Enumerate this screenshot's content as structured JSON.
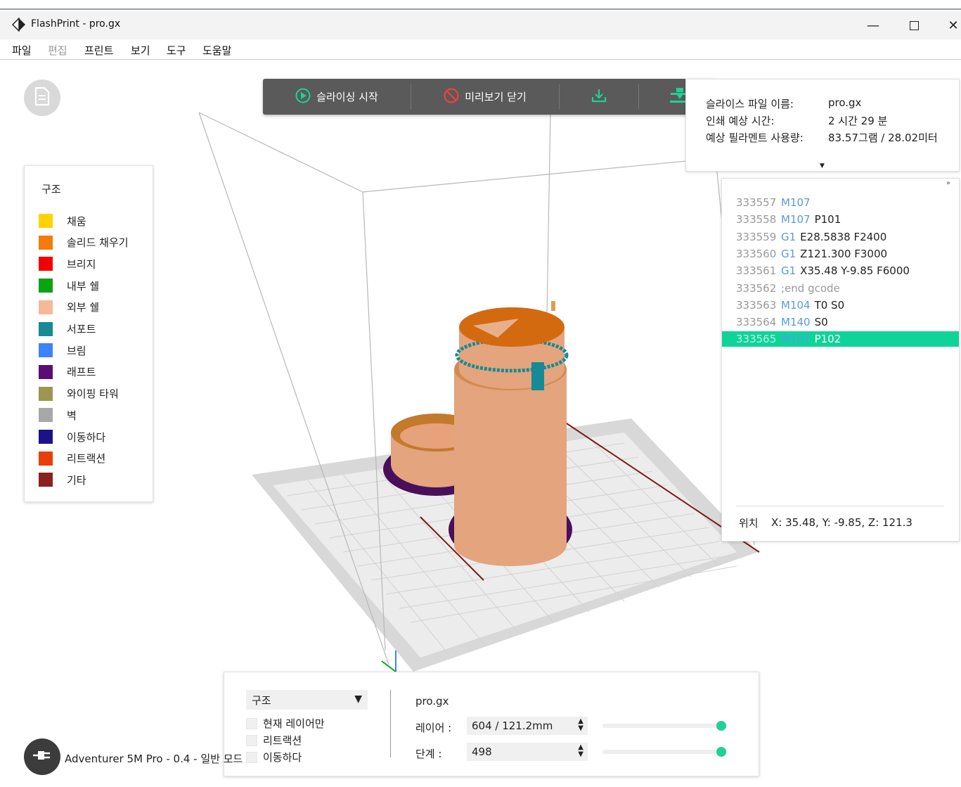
{
  "window": {
    "title": "FlashPrint - pro.gx",
    "icon": "flashprint-logo-icon",
    "controls": [
      "minimize-icon",
      "maximize-icon",
      "close-icon"
    ]
  },
  "menu": [
    "파일",
    "편집",
    "프린트",
    "보기",
    "도구",
    "도움말"
  ],
  "toolbar": {
    "slice_label": "슬라이싱 시작",
    "close_preview_label": "미리보기 닫기",
    "accent": "#1fd195"
  },
  "info": {
    "file_label": "슬라이스 파일 이름:",
    "file_value": "pro.gx",
    "time_label": "인쇄 예상 시간:",
    "time_value": "2 시간 29 분",
    "filament_label": "예상 필라멘트 사용량:",
    "filament_value": "83.57그램 / 28.02미터"
  },
  "legend": {
    "title": "구조",
    "items": [
      {
        "label": "채움",
        "color": "#ffd200"
      },
      {
        "label": "솔리드 채우기",
        "color": "#f57b0a"
      },
      {
        "label": "브리지",
        "color": "#f20000"
      },
      {
        "label": "내부 쉘",
        "color": "#0ba312"
      },
      {
        "label": "외부 쉘",
        "color": "#f5b99a"
      },
      {
        "label": "서포트",
        "color": "#168a95"
      },
      {
        "label": "브림",
        "color": "#3d82ff"
      },
      {
        "label": "래프트",
        "color": "#590f72"
      },
      {
        "label": "와이핑 타워",
        "color": "#9c9650"
      },
      {
        "label": "벽",
        "color": "#a8a8a8"
      },
      {
        "label": "이동하다",
        "color": "#1c118a"
      },
      {
        "label": "리트랙션",
        "color": "#e8400a"
      },
      {
        "label": "기타",
        "color": "#8b2020"
      }
    ]
  },
  "gcode": {
    "lines": [
      {
        "num": "333557",
        "cmd": "M107",
        "args": ""
      },
      {
        "num": "333558",
        "cmd": "M107",
        "args": "P101"
      },
      {
        "num": "333559",
        "cmd": "G1",
        "args": "E28.5838 F2400"
      },
      {
        "num": "333560",
        "cmd": "G1",
        "args": "Z121.300 F3000"
      },
      {
        "num": "333561",
        "cmd": "G1",
        "args": "X35.48 Y-9.85 F6000"
      },
      {
        "num": "333562",
        "cmd": "",
        "args": ";end gcode"
      },
      {
        "num": "333563",
        "cmd": "M104",
        "args": "T0 S0"
      },
      {
        "num": "333564",
        "cmd": "M140",
        "args": "S0"
      },
      {
        "num": "333565",
        "cmd": "M107",
        "args": "P102",
        "selected": true
      }
    ],
    "position_label": "위치",
    "position_value": "X: 35.48, Y: -9.85, Z: 121.3"
  },
  "bottom": {
    "view_mode": "구조",
    "checkboxes": [
      {
        "label": "현재 레이어만",
        "checked": false
      },
      {
        "label": "리트랙션",
        "checked": false
      },
      {
        "label": "이동하다",
        "checked": false
      }
    ],
    "file_name": "pro.gx",
    "layer_label": "레이어 :",
    "layer_value": "604 / 121.2mm",
    "layer_slider": 1.0,
    "step_label": "단계 :",
    "step_value": "498",
    "step_slider": 1.0
  },
  "printer": {
    "label": "Adventurer 5M Pro - 0.4 - 일반 모드"
  }
}
